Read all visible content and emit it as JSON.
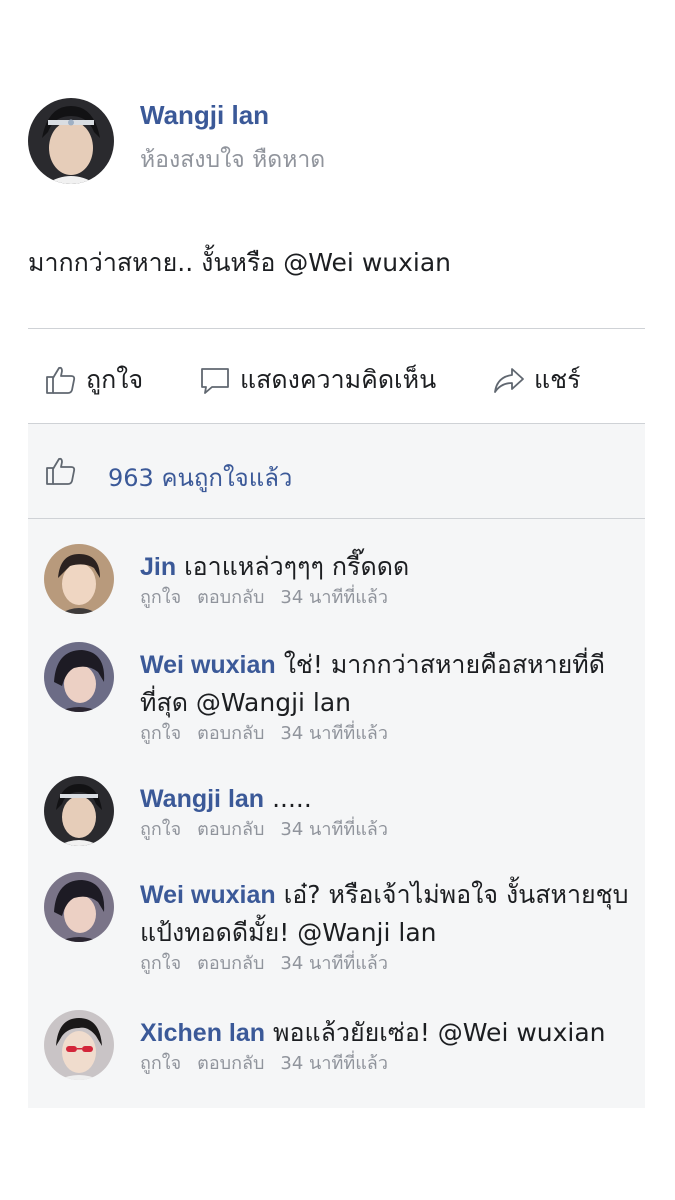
{
  "post": {
    "author": "Wangji lan",
    "location": "ห้องสงบใจ หืดหาด",
    "text": "มากกว่าสหาย.. งั้นหรือ @Wei wuxian"
  },
  "actions": {
    "like": "ถูกใจ",
    "comment": "แสดงความคิดเห็น",
    "share": "แชร์"
  },
  "likes": {
    "count_text": "963 คนถูกใจแล้ว"
  },
  "comments": [
    {
      "author": "Jin",
      "text": "เอาแหล่วๆๆๆ กรี๊ดดด",
      "like_label": "ถูกใจ",
      "reply_label": "ตอบกลับ",
      "time": "34 นาทีที่แล้ว"
    },
    {
      "author": "Wei wuxian",
      "text": "ใช่! มากกว่าสหายคือสหายที่ดีที่สุด @Wangji lan",
      "like_label": "ถูกใจ",
      "reply_label": "ตอบกลับ",
      "time": "34 นาทีที่แล้ว"
    },
    {
      "author": "Wangji lan",
      "text": ".....",
      "like_label": "ถูกใจ",
      "reply_label": "ตอบกลับ",
      "time": "34 นาทีที่แล้ว"
    },
    {
      "author": "Wei wuxian",
      "text": "เอ๋? หรือเจ้าไม่พอใจ งั้นสหายชุบแป้งทอดดีมั้ย! @Wanji lan",
      "like_label": "ถูกใจ",
      "reply_label": "ตอบกลับ",
      "time": "34 นาทีที่แล้ว"
    },
    {
      "author": "Xichen lan",
      "text": "พอแล้วยัยเซ่อ! @Wei wuxian",
      "like_label": "ถูกใจ",
      "reply_label": "ตอบกลับ",
      "time": "34 นาทีที่แล้ว"
    }
  ],
  "colors": {
    "name_blue": "#3b5998",
    "meta_gray": "#90949c",
    "panel_bg": "#f5f6f7"
  },
  "icons": {
    "like": "thumbs-up-icon",
    "comment": "speech-bubble-icon",
    "share": "share-arrow-icon"
  }
}
